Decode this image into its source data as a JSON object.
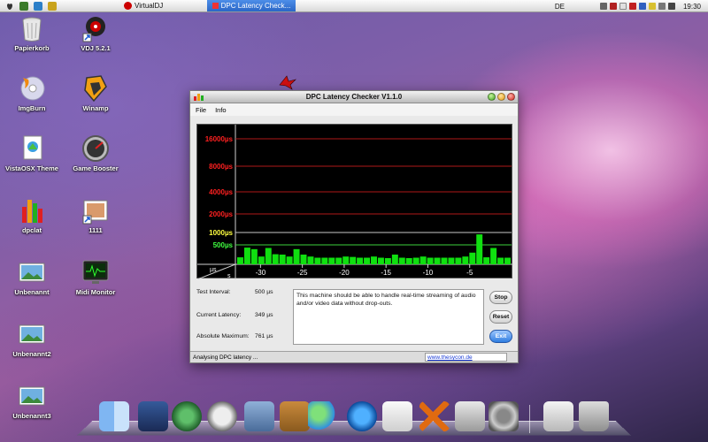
{
  "taskbar": {
    "tasks": [
      {
        "label": "VirtualDJ",
        "active": false
      },
      {
        "label": "DPC Latency Check...",
        "active": true
      }
    ],
    "language": "DE",
    "clock": "19:30"
  },
  "desktop_icons": [
    {
      "label": "Papierkorb",
      "icon": "trash-icon"
    },
    {
      "label": "VDJ 5.2.1",
      "icon": "vdj-icon"
    },
    {
      "label": "ImgBurn",
      "icon": "disc-icon"
    },
    {
      "label": "Winamp",
      "icon": "winamp-icon"
    },
    {
      "label": "VistaOSX Theme",
      "icon": "theme-icon"
    },
    {
      "label": "Game Booster",
      "icon": "gauge-icon"
    },
    {
      "label": "dpclat",
      "icon": "bars-icon"
    },
    {
      "label": "1111",
      "icon": "image-icon"
    },
    {
      "label": "Unbenannt",
      "icon": "landscape-icon"
    },
    {
      "label": "Midi Monitor",
      "icon": "monitor-icon"
    },
    {
      "label": "Unbenannt2",
      "icon": "landscape-icon"
    },
    {
      "label": "Unbenannt3",
      "icon": "landscape-icon"
    }
  ],
  "window": {
    "title": "DPC Latency Checker V1.1.0",
    "menu": [
      "File",
      "Info"
    ],
    "info": {
      "test_interval_label": "Test Interval:",
      "test_interval_value": "500 µs",
      "current_latency_label": "Current Latency:",
      "current_latency_value": "349 µs",
      "absolute_maximum_label": "Absolute Maximum:",
      "absolute_maximum_value": "761 µs"
    },
    "message": "This machine should be able to handle real-time streaming of audio and/or video data without drop-outs.",
    "buttons": {
      "stop": "Stop",
      "reset": "Reset",
      "exit": "Exit"
    },
    "status": "Analysing DPC latency ...",
    "link": "www.thesycon.de"
  },
  "chart_data": {
    "type": "bar",
    "ylabel": "µs",
    "xlabel": "s",
    "y_ticks": [
      {
        "label": "16000µs",
        "color": "#ff2020"
      },
      {
        "label": "8000µs",
        "color": "#ff2020"
      },
      {
        "label": "4000µs",
        "color": "#ff2020"
      },
      {
        "label": "2000µs",
        "color": "#ff2020"
      },
      {
        "label": "1000µs",
        "color": "#ffff40"
      },
      {
        "label": "500µs",
        "color": "#40ff40"
      }
    ],
    "x_ticks": [
      "-30",
      "-25",
      "-20",
      "-15",
      "-10",
      "-5"
    ],
    "x_range": [
      -33,
      0
    ],
    "bar_values_us": [
      180,
      430,
      390,
      200,
      420,
      260,
      250,
      200,
      390,
      250,
      200,
      170,
      170,
      170,
      170,
      200,
      190,
      170,
      170,
      200,
      170,
      160,
      250,
      170,
      160,
      170,
      200,
      170,
      170,
      170,
      170,
      170,
      200,
      300,
      900,
      180,
      420,
      170,
      170
    ],
    "colors": {
      "bar": "#10e010",
      "grid_red": "#b01818",
      "grid_yellow": "#c8c8c8",
      "background": "#000000"
    }
  },
  "dock_items": [
    "finder-icon",
    "dashboard-icon",
    "time-machine-icon",
    "safari-icon",
    "mail-icon",
    "address-book-icon",
    "messenger-icon",
    "quicktime-icon",
    "textedit-icon",
    "xcode-icon",
    "utilities-icon",
    "system-prefs-icon",
    "preview-icon",
    "trash-icon"
  ]
}
